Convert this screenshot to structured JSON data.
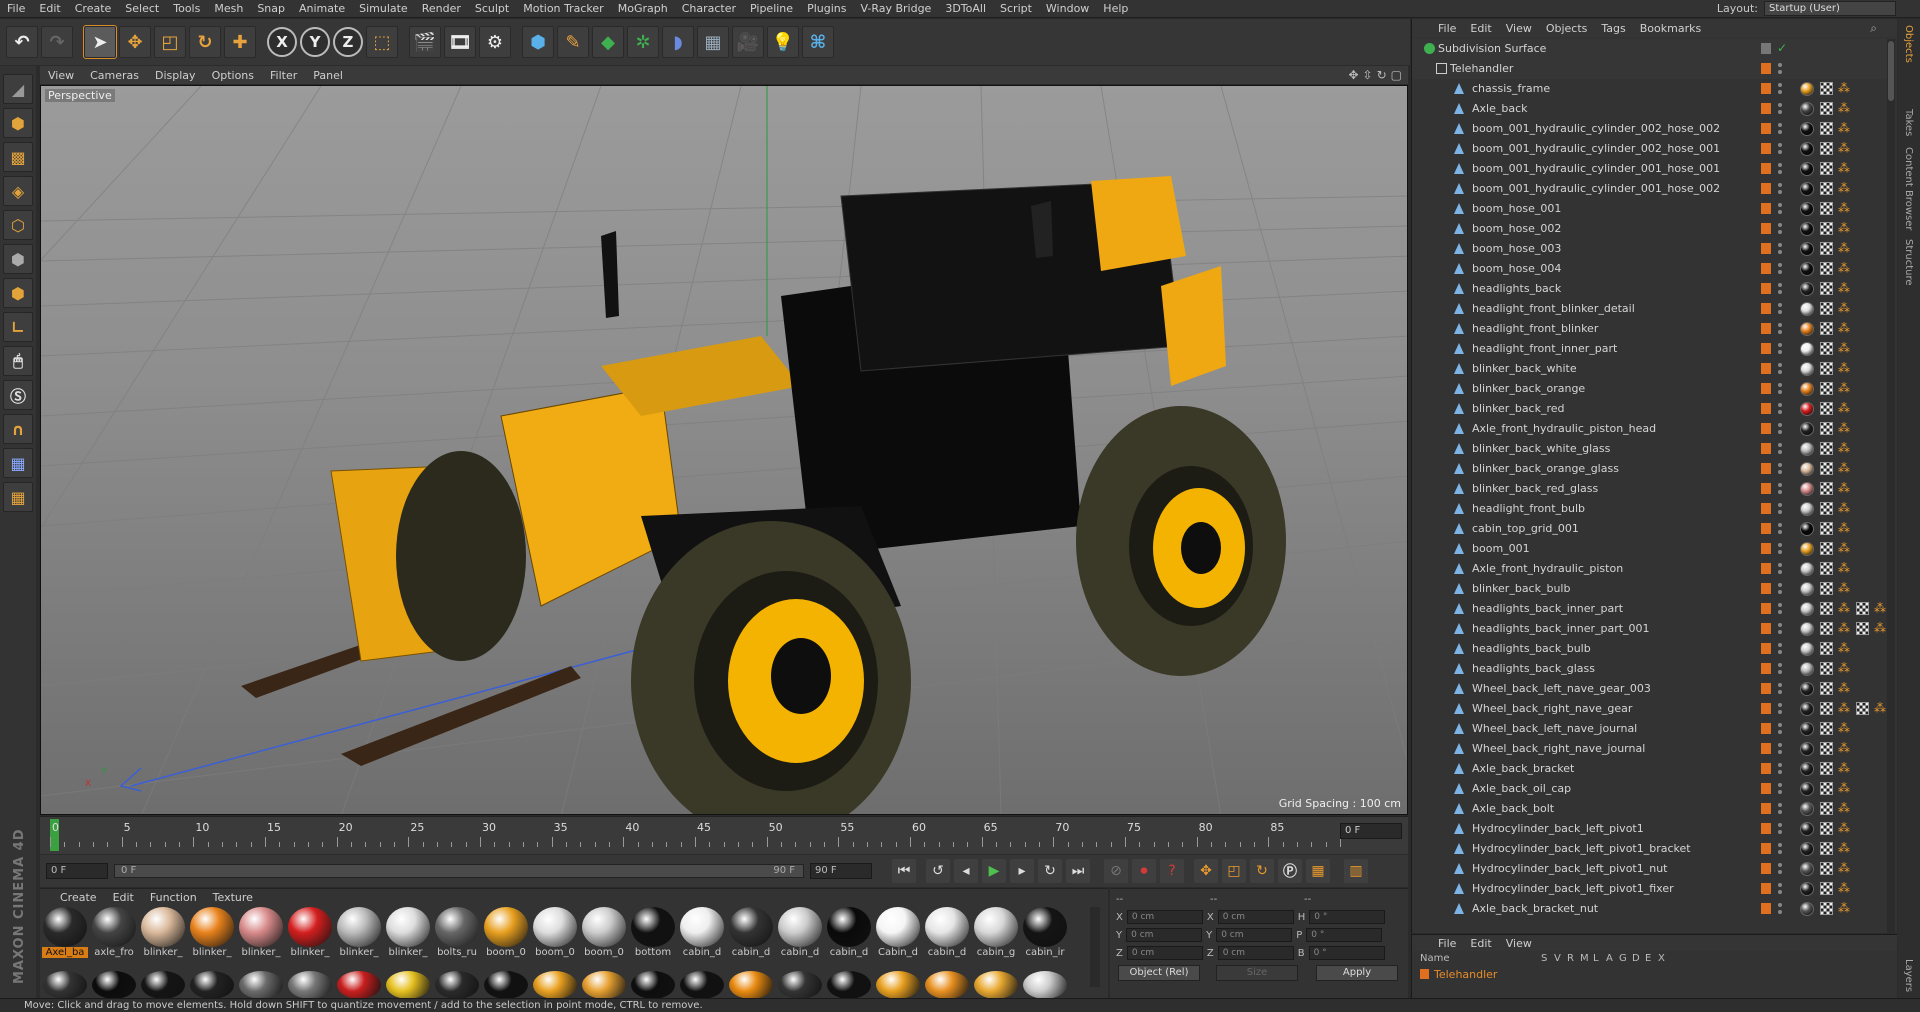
{
  "menubar": {
    "items": [
      "File",
      "Edit",
      "Create",
      "Select",
      "Tools",
      "Mesh",
      "Snap",
      "Animate",
      "Simulate",
      "Render",
      "Sculpt",
      "Motion Tracker",
      "MoGraph",
      "Character",
      "Pipeline",
      "Plugins",
      "V-Ray Bridge",
      "3DToAll",
      "Script",
      "Window",
      "Help"
    ],
    "layout_label": "Layout:",
    "layout_value": "Startup (User)"
  },
  "toolbar": {
    "buttons": [
      "undo-icon",
      "redo-icon",
      "select-icon",
      "move-icon",
      "scale-icon",
      "rotate-icon",
      "live-select-icon",
      "x-axis-lock",
      "y-axis-lock",
      "z-axis-lock",
      "world-coordinate-icon",
      "render-view-icon",
      "render-picture-viewer-icon",
      "render-settings-icon",
      "cube-icon",
      "pen-spline-icon",
      "subdivision-icon",
      "cloner-icon",
      "deformer-icon",
      "floor-icon",
      "camera-icon",
      "light-icon",
      "python-icon"
    ],
    "axis_labels": [
      "X",
      "Y",
      "Z"
    ]
  },
  "viewport": {
    "menu": [
      "View",
      "Cameras",
      "Display",
      "Options",
      "Filter",
      "Panel"
    ],
    "label": "Perspective",
    "grid_spacing": "Grid Spacing : 100 cm",
    "axis_y": "Y",
    "axis_x": "X"
  },
  "timeline": {
    "ticks": [
      "0",
      "5",
      "10",
      "15",
      "20",
      "25",
      "30",
      "35",
      "40",
      "45",
      "50",
      "55",
      "60",
      "65",
      "70",
      "75",
      "80",
      "85",
      "90"
    ],
    "current_frame": "0 F"
  },
  "transport": {
    "start_field": "0 F",
    "slider_start": "0 F",
    "slider_end": "90 F",
    "end_field": "90 F"
  },
  "materials": {
    "menu": [
      "Create",
      "Edit",
      "Function",
      "Texture"
    ],
    "row1": [
      {
        "label": "Axel_ba",
        "color": "#2a2a2a",
        "selected": true
      },
      {
        "label": "axle_fro",
        "color": "#444"
      },
      {
        "label": "blinker_",
        "color": "#d9b89a"
      },
      {
        "label": "blinker_",
        "color": "#e8821c"
      },
      {
        "label": "blinker_",
        "color": "#d88a8a"
      },
      {
        "label": "blinker_",
        "color": "#d41e1e"
      },
      {
        "label": "blinker_",
        "color": "#bbbbbb"
      },
      {
        "label": "blinker_",
        "color": "#dddddd"
      },
      {
        "label": "bolts_ru",
        "color": "#666"
      },
      {
        "label": "boom_0",
        "color": "#e8a020"
      },
      {
        "label": "boom_0",
        "color": "#ddd"
      },
      {
        "label": "boom_0",
        "color": "#ccc"
      },
      {
        "label": "bottom",
        "color": "#111"
      },
      {
        "label": "cabin_d",
        "color": "#eee"
      },
      {
        "label": "cabin_d",
        "color": "#333"
      },
      {
        "label": "cabin_d",
        "color": "#ccc"
      },
      {
        "label": "cabin_d",
        "color": "#0a0a0a"
      },
      {
        "label": "Cabin_d",
        "color": "#f5f5f5"
      },
      {
        "label": "cabin_d",
        "color": "#e5e5e5"
      },
      {
        "label": "cabin_g",
        "color": "#d8d8d8"
      },
      {
        "label": "cabin_ir",
        "color": "#141414"
      }
    ],
    "row2": [
      "#333",
      "#0c0c0c",
      "#151515",
      "#222",
      "#6a6a6a",
      "#777",
      "#c81e1e",
      "#e6c020",
      "#2a2a2a",
      "#111",
      "#e8a020",
      "#e6a030",
      "#0e0e0e",
      "#111",
      "#e88a10",
      "#333",
      "#111",
      "#e8a020",
      "#e89020",
      "#e8a830",
      "#ccc"
    ]
  },
  "coords": {
    "headers": [
      "--",
      "--",
      "--"
    ],
    "rows": [
      {
        "a": "X",
        "av": "0 cm",
        "b": "X",
        "bv": "0 cm",
        "c": "H",
        "cv": "0 °"
      },
      {
        "a": "Y",
        "av": "0 cm",
        "b": "Y",
        "bv": "0 cm",
        "c": "P",
        "cv": "0 °"
      },
      {
        "a": "Z",
        "av": "0 cm",
        "b": "Z",
        "bv": "0 cm",
        "c": "B",
        "cv": "0 °"
      }
    ],
    "mode": "Object (Rel)",
    "size": "Size",
    "apply": "Apply"
  },
  "object_manager": {
    "menu": [
      "File",
      "Edit",
      "View",
      "Objects",
      "Tags",
      "Bookmarks"
    ],
    "root": "Subdivision Surface",
    "group": "Telehandler",
    "objects": [
      {
        "name": "chassis_frame",
        "mat": "#e8a020"
      },
      {
        "name": "Axle_back",
        "mat": "#444"
      },
      {
        "name": "boom_001_hydraulic_cylinder_002_hose_002",
        "mat": "#111"
      },
      {
        "name": "boom_001_hydraulic_cylinder_002_hose_001",
        "mat": "#111"
      },
      {
        "name": "boom_001_hydraulic_cylinder_001_hose_001",
        "mat": "#111"
      },
      {
        "name": "boom_001_hydraulic_cylinder_001_hose_002",
        "mat": "#111"
      },
      {
        "name": "boom_hose_001",
        "mat": "#111"
      },
      {
        "name": "boom_hose_002",
        "mat": "#111"
      },
      {
        "name": "boom_hose_003",
        "mat": "#111"
      },
      {
        "name": "boom_hose_004",
        "mat": "#111"
      },
      {
        "name": "headlights_back",
        "mat": "#222"
      },
      {
        "name": "headlight_front_blinker_detail",
        "mat": "#ddd"
      },
      {
        "name": "headlight_front_blinker",
        "mat": "#e8821c"
      },
      {
        "name": "headlight_front_inner_part",
        "mat": "#eee"
      },
      {
        "name": "blinker_back_white",
        "mat": "#ddd"
      },
      {
        "name": "blinker_back_orange",
        "mat": "#e8821c"
      },
      {
        "name": "blinker_back_red",
        "mat": "#d41e1e"
      },
      {
        "name": "Axle_front_hydraulic_piston_head",
        "mat": "#222"
      },
      {
        "name": "blinker_back_white_glass",
        "mat": "#bbb"
      },
      {
        "name": "blinker_back_orange_glass",
        "mat": "#d9b89a"
      },
      {
        "name": "blinker_back_red_glass",
        "mat": "#d88a8a"
      },
      {
        "name": "headlight_front_bulb",
        "mat": "#ccc"
      },
      {
        "name": "cabin_top_grid_001",
        "mat": "#0a0a0a"
      },
      {
        "name": "boom_001",
        "mat": "#e8a020"
      },
      {
        "name": "Axle_front_hydraulic_piston",
        "mat": "#ccc"
      },
      {
        "name": "blinker_back_bulb",
        "mat": "#ccc"
      },
      {
        "name": "headlights_back_inner_part",
        "mat": "#ccc",
        "extra": true
      },
      {
        "name": "headlights_back_inner_part_001",
        "mat": "#ccc",
        "extra": true
      },
      {
        "name": "headlights_back_bulb",
        "mat": "#ccc"
      },
      {
        "name": "headlights_back_glass",
        "mat": "#bbb"
      },
      {
        "name": "Wheel_back_left_nave_gear_003",
        "mat": "#222"
      },
      {
        "name": "Wheel_back_right_nave_gear",
        "mat": "#222",
        "extra": true
      },
      {
        "name": "Wheel_back_left_nave_journal",
        "mat": "#222"
      },
      {
        "name": "Wheel_back_right_nave_journal",
        "mat": "#222"
      },
      {
        "name": "Axle_back_bracket",
        "mat": "#222"
      },
      {
        "name": "Axle_back_oil_cap",
        "mat": "#222"
      },
      {
        "name": "Axle_back_bolt",
        "mat": "#555"
      },
      {
        "name": "Hydrocylinder_back_left_pivot1",
        "mat": "#222"
      },
      {
        "name": "Hydrocylinder_back_left_pivot1_bracket",
        "mat": "#222"
      },
      {
        "name": "Hydrocylinder_back_left_pivot1_nut",
        "mat": "#555"
      },
      {
        "name": "Hydrocylinder_back_left_pivot1_fixer",
        "mat": "#222"
      },
      {
        "name": "Axle_back_bracket_nut",
        "mat": "#555"
      }
    ]
  },
  "attributes": {
    "menu": [
      "File",
      "Edit",
      "View"
    ],
    "columns": [
      "Name",
      "S",
      "V",
      "R",
      "M",
      "L",
      "A",
      "G",
      "D",
      "E",
      "X"
    ],
    "row_name": "Telehandler"
  },
  "right_tabs": [
    "Objects",
    "Takes",
    "Content Browser",
    "Structure",
    "Layers"
  ],
  "status": "Move: Click and drag to move elements. Hold down SHIFT to quantize movement / add to the selection in point mode, CTRL to remove."
}
